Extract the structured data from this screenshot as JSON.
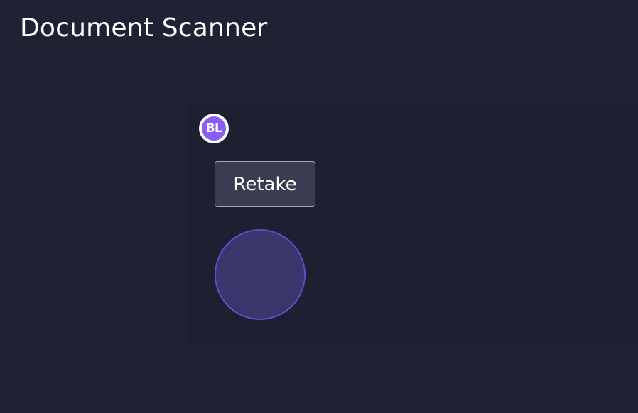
{
  "header": {
    "title": "Document Scanner"
  },
  "scanner": {
    "avatar_initials": "BL",
    "retake_label": "Retake",
    "capture_icon": "shutter-circle"
  },
  "colors": {
    "background": "#1f2232",
    "panel": "#1d2030",
    "avatar_accent": "#8b5cf6",
    "button_bg": "#3a3d52",
    "button_border": "#9ea3b7",
    "capture_fill": "#3b366c",
    "capture_border": "#5b4fd0"
  }
}
